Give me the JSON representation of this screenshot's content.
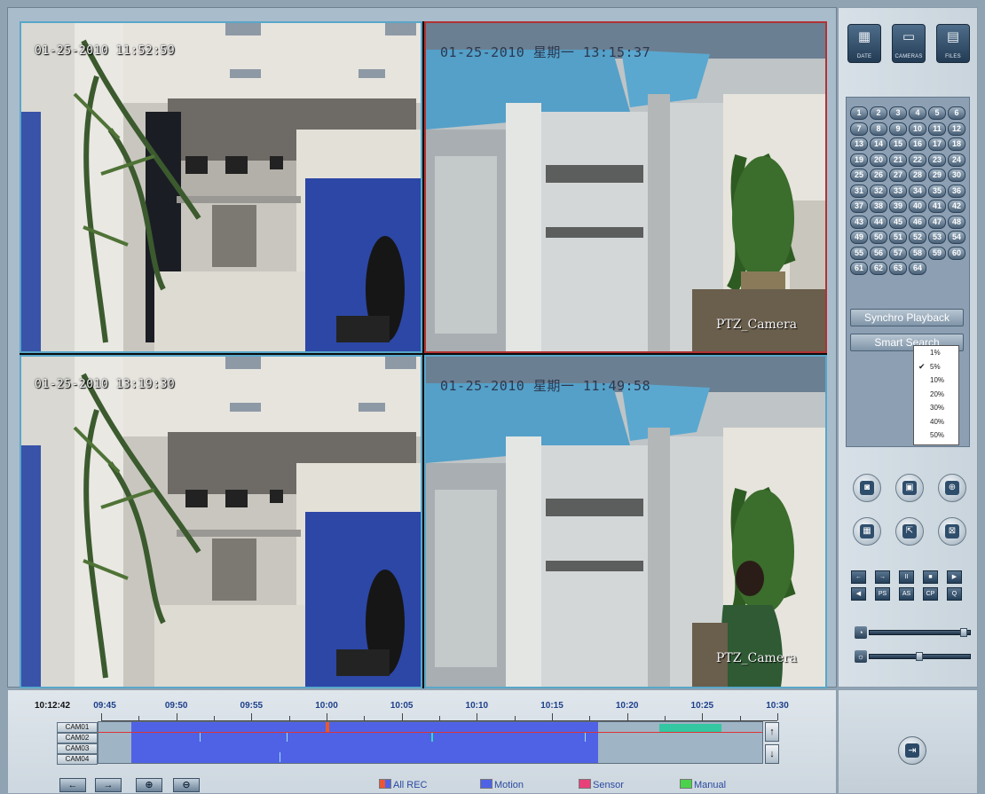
{
  "toolbar": {
    "date_label": "DATE",
    "camera_label": "CAMERAS",
    "files_label": "FILES"
  },
  "cameras": [
    {
      "timestamp": "01-25-2010 11:52:59",
      "name": ""
    },
    {
      "timestamp": "01-25-2010 星期一 13:15:37",
      "name": "PTZ_Camera"
    },
    {
      "timestamp": "01-25-2010 13:19:30",
      "name": ""
    },
    {
      "timestamp": "01-25-2010 星期一 11:49:58",
      "name": "PTZ_Camera"
    }
  ],
  "channels": [
    "1",
    "2",
    "3",
    "4",
    "5",
    "6",
    "7",
    "8",
    "9",
    "10",
    "11",
    "12",
    "13",
    "14",
    "15",
    "16",
    "17",
    "18",
    "19",
    "20",
    "21",
    "22",
    "23",
    "24",
    "25",
    "26",
    "27",
    "28",
    "29",
    "30",
    "31",
    "32",
    "33",
    "34",
    "35",
    "36",
    "37",
    "38",
    "39",
    "40",
    "41",
    "42",
    "43",
    "44",
    "45",
    "46",
    "47",
    "48",
    "49",
    "50",
    "51",
    "52",
    "53",
    "54",
    "55",
    "56",
    "57",
    "58",
    "59",
    "60",
    "61",
    "62",
    "63",
    "64"
  ],
  "buttons": {
    "synchro_playback": "Synchro Playback",
    "smart_search": "Smart Search"
  },
  "speed_menu": {
    "options": [
      "1%",
      "5%",
      "10%",
      "20%",
      "30%",
      "40%",
      "50%"
    ],
    "selected": "5%"
  },
  "playback_buttons": {
    "row1": [
      "←",
      "→",
      "II",
      "■",
      "▶"
    ],
    "row2": [
      "◀",
      "PS",
      "AS",
      "CP",
      "Q"
    ]
  },
  "timeline": {
    "current_time": "10:12:42",
    "ticks": [
      "09:45",
      "09:50",
      "09:55",
      "10:00",
      "10:05",
      "10:10",
      "10:15",
      "10:20",
      "10:25",
      "10:30"
    ],
    "camera_rows": [
      "CAM01",
      "CAM02",
      "CAM03",
      "CAM04"
    ]
  },
  "legend": {
    "all_rec": "All REC",
    "motion": "Motion",
    "sensor": "Sensor",
    "manual": "Manual"
  },
  "colors": {
    "motion": "#4f62e6",
    "manual": "#33c7a2",
    "sensor": "#e85a2a",
    "track_bg": "#9fb4c4"
  }
}
